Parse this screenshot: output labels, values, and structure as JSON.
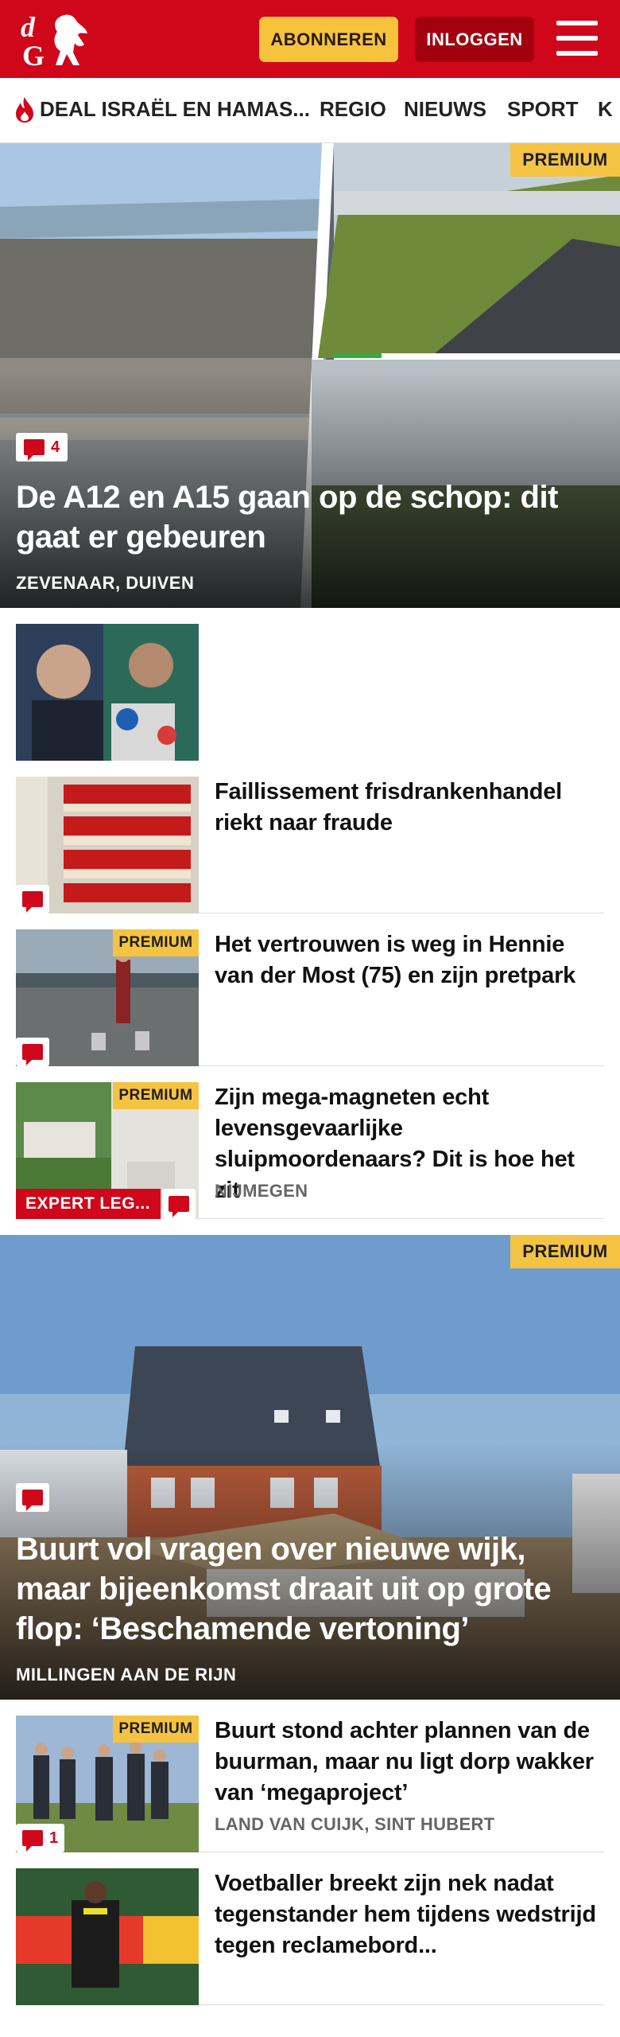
{
  "header": {
    "logo_text": "dG",
    "subscribe_label": "ABONNEREN",
    "login_label": "INLOGGEN",
    "brand_color": "#d0071a"
  },
  "nav": {
    "items": [
      {
        "label": "DEAL ISRAËL EN HAMAS..."
      },
      {
        "label": "REGIO"
      },
      {
        "label": "NIEUWS"
      },
      {
        "label": "SPORT"
      },
      {
        "label": "K"
      }
    ]
  },
  "hero": {
    "premium_label": "PREMIUM",
    "comments": "4",
    "title": "De A12 en A15 gaan op de schop: dit gaat er gebeuren",
    "location": "ZEVENAAR, DUIVEN"
  },
  "articles": [
    {
      "title": "",
      "location": ""
    },
    {
      "title": "Faillissement frisdrankenhandel riekt naar fraude"
    },
    {
      "premium_label": "PREMIUM",
      "title": "Het vertrouwen is weg in Hennie van der Most (75) en zijn pretpark"
    },
    {
      "premium_label": "PREMIUM",
      "expert_label": "EXPERT LEG...",
      "title": "Zijn mega-magneten echt levensgevaarlijke sluipmoordenaars? Dit is hoe het zit",
      "location": "NIJMEGEN"
    }
  ],
  "feature": {
    "premium_label": "PREMIUM",
    "title": "Buurt vol vragen over nieuwe wijk, maar bijeenkomst draait uit op grote flop: ‘Beschamende vertoning’",
    "location": "MILLINGEN AAN DE RIJN"
  },
  "articles2": [
    {
      "premium_label": "PREMIUM",
      "comments": "1",
      "title": "Buurt stond achter plannen van de buurman, maar nu ligt dorp wakker van ‘megaproject’",
      "location": "LAND VAN CUIJK, SINT HUBERT"
    },
    {
      "title": "Voetballer breekt zijn nek nadat tegenstander hem tijdens wedstrijd tegen reclamebord..."
    }
  ]
}
